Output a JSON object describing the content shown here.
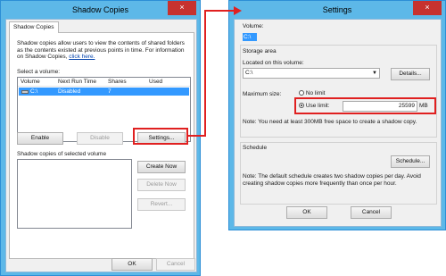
{
  "shadow": {
    "title": "Shadow Copies",
    "close": "×",
    "tab": "Shadow Copies",
    "intro": "Shadow copies allow users to view the contents of shared folders as the contents existed at previous points in time. For information on Shadow Copies,",
    "link": "click here.",
    "select_label": "Select a volume:",
    "columns": [
      "Volume",
      "Next Run Time",
      "Shares",
      "Used"
    ],
    "row": {
      "volume": "C:\\",
      "next_run": "Disabled",
      "shares": "7",
      "used": ""
    },
    "enable": "Enable",
    "disable": "Disable",
    "settings": "Settings...",
    "copies_label": "Shadow copies of selected volume",
    "create_now": "Create Now",
    "delete_now": "Delete Now",
    "revert": "Revert...",
    "ok": "OK",
    "cancel": "Cancel"
  },
  "settings": {
    "title": "Settings",
    "close": "×",
    "volume_label": "Volume:",
    "volume_value": "C:\\",
    "storage_label": "Storage area",
    "located_label": "Located on this volume:",
    "located_value": "C:\\",
    "details": "Details...",
    "max_label": "Maximum size:",
    "no_limit": "No limit",
    "use_limit": "Use limit:",
    "limit_value": "25599",
    "unit": "MB",
    "note1": "Note: You need at least 300MB free space to create a shadow copy.",
    "schedule_label": "Schedule",
    "schedule_btn": "Schedule...",
    "note2": "Note: The default schedule creates two shadow copies per day. Avoid creating shadow copies more frequently than once per hour.",
    "ok": "OK",
    "cancel": "Cancel"
  },
  "colors": {
    "frame": "#5db8e8",
    "close": "#c7322f",
    "highlight": "#e02020",
    "selection": "#3399ff"
  }
}
